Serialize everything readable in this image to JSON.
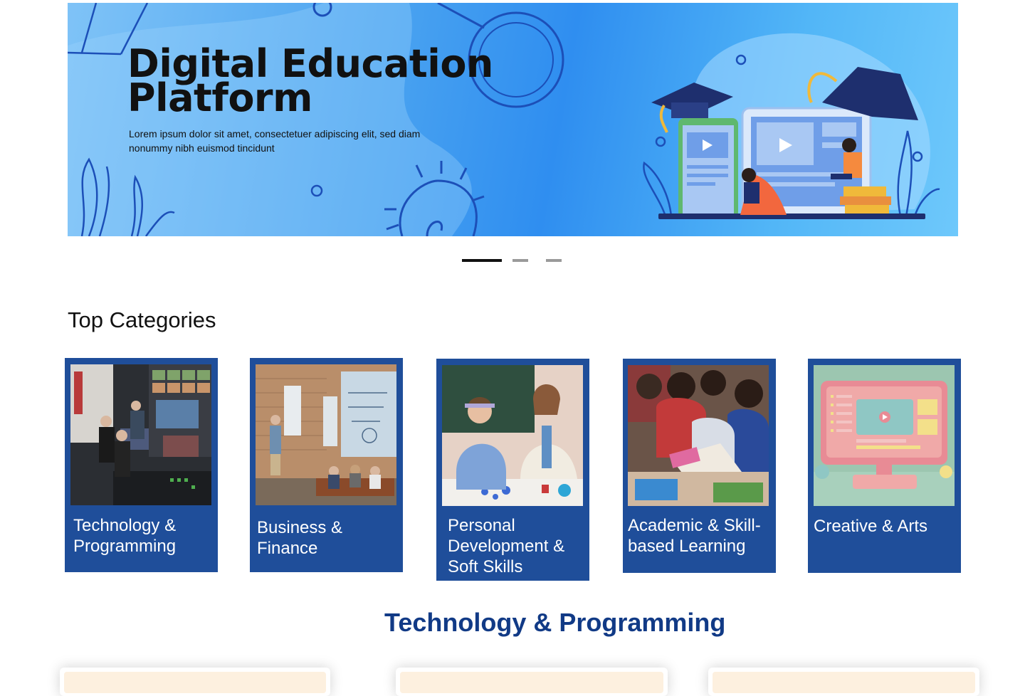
{
  "banner": {
    "title": "Digital Education Platform",
    "subtitle": "Lorem ipsum dolor sit amet, consectetuer adipiscing elit, sed diam nonummy nibh euismod tincidunt"
  },
  "carousel": {
    "slide_count": 3,
    "active_index": 0
  },
  "categories": {
    "title": "Top Categories",
    "items": [
      {
        "label": "Technology & Programming"
      },
      {
        "label": "Business & Finance"
      },
      {
        "label": "Personal Development & Soft Skills"
      },
      {
        "label": "Academic & Skill-based Learning"
      },
      {
        "label": "Creative & Arts"
      }
    ]
  },
  "featured": {
    "title": "Technology & Programming"
  },
  "colors": {
    "card_bg": "#1f4e9a",
    "featured_title": "#113a86",
    "banner_blue": "#2f8ef0"
  }
}
